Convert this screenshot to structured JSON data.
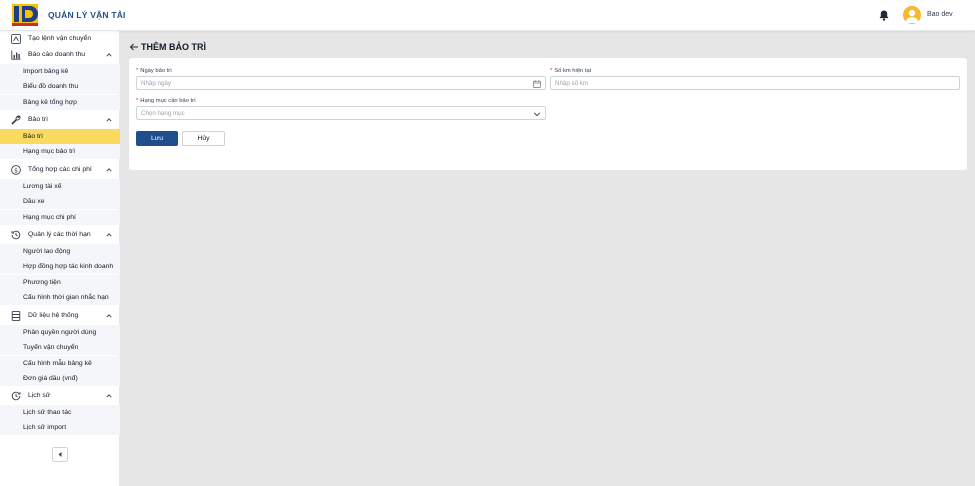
{
  "header": {
    "app_title": "QUẢN LÝ VẬN TẢI",
    "user_name": "Bao dev",
    "brand_color": "#1f4e8c",
    "accent_color": "#f5b82e"
  },
  "sidebar": {
    "top_item": {
      "label": "Tạo lệnh vận chuyển",
      "icon": "new-order-icon"
    },
    "groups": [
      {
        "label": "Báo cáo doanh thu",
        "icon": "bar-chart-icon",
        "items": [
          "Import bảng kê",
          "Biểu đồ doanh thu",
          "Bảng kê tổng hợp"
        ]
      },
      {
        "label": "Bảo trì",
        "icon": "wrench-icon",
        "items": [
          "Bảo trì",
          "Hạng mục bảo trì"
        ]
      },
      {
        "label": "Tổng hợp các chi phí",
        "icon": "dollar-circle-icon",
        "items": [
          "Lương tài xế",
          "Dầu xe",
          "Hạng mục chi phí"
        ]
      },
      {
        "label": "Quản lý các thời hạn",
        "icon": "clock-history-icon",
        "items": [
          "Người lao động",
          "Hợp đồng hợp tác kinh doanh",
          "Phương tiện",
          "Cấu hình thời gian nhắc hạn"
        ]
      },
      {
        "label": "Dữ liệu hệ thống",
        "icon": "database-icon",
        "items": [
          "Phân quyền người dùng",
          "Tuyến vận chuyển",
          "Cấu hình mẫu bảng kê",
          "Đơn giá dầu (vnđ)"
        ]
      },
      {
        "label": "Lịch sử",
        "icon": "history-icon",
        "items": [
          "Lịch sử thao tác",
          "Lịch sử import"
        ]
      }
    ],
    "active_item": "Bảo trì",
    "active_color": "#fadb5f"
  },
  "page": {
    "title": "THÊM BẢO TRÌ"
  },
  "form": {
    "date": {
      "label": "Ngày bảo trì",
      "placeholder": "Nhập ngày"
    },
    "km": {
      "label": "Số km hiện tại",
      "placeholder": "Nhập số km"
    },
    "category": {
      "label": "Hạng mục cần bảo trì",
      "placeholder": "Chọn hạng mục"
    },
    "required_mark": "*",
    "save_label": "Lưu",
    "cancel_label": "Hủy"
  }
}
